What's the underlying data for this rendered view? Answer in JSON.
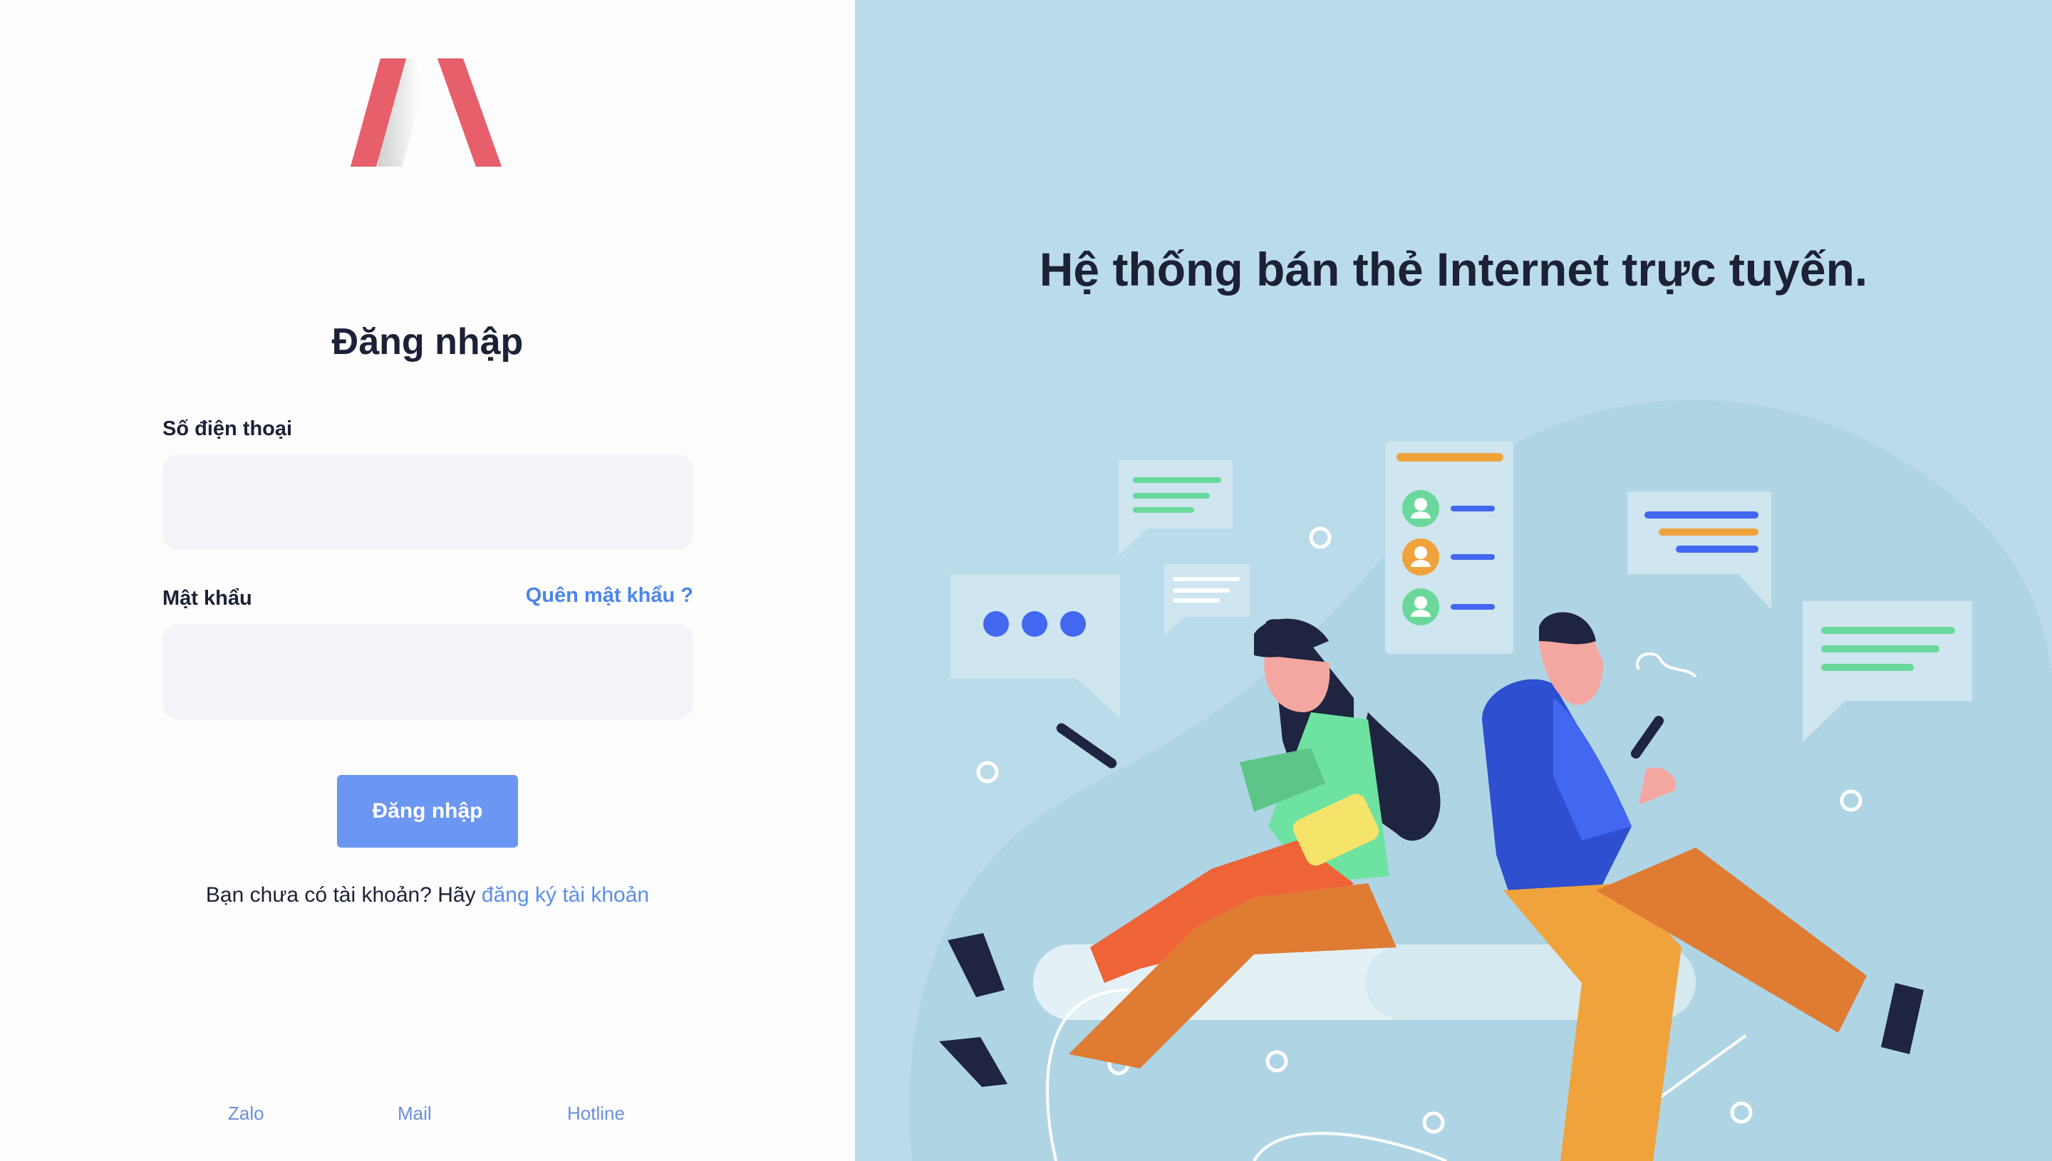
{
  "login": {
    "title": "Đăng nhập",
    "phone_label": "Số điện thoại",
    "phone_value": "",
    "password_label": "Mật khẩu",
    "password_value": "",
    "forgot_link": "Quên mật khẩu ?",
    "submit_label": "Đăng nhập",
    "register_prompt": "Bạn chưa có tài khoản? Hãy ",
    "register_link": "đăng ký tài khoản"
  },
  "footer": {
    "links": [
      "Zalo",
      "Mail",
      "Hotline"
    ]
  },
  "hero": {
    "headline": "Hệ thống bán thẻ Internet trực tuyến."
  },
  "colors": {
    "brand": "#e65f6b",
    "accent": "#6b96f1",
    "link": "#4a86ea",
    "hero_background": "#badbea",
    "text_dark": "#1c2137"
  },
  "icons": [
    "logo-icon",
    "chat-bubble-icon",
    "user-avatar-icon",
    "phone-icon"
  ]
}
